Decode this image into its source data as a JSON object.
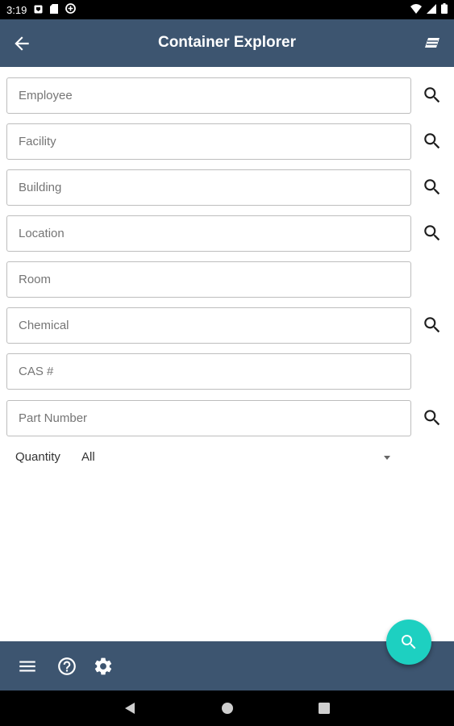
{
  "status_bar": {
    "time": "3:19",
    "left_icons": [
      "notification-icon",
      "sd-card-icon",
      "sync-icon"
    ],
    "right_icons": [
      "wifi-icon",
      "signal-icon",
      "battery-icon"
    ]
  },
  "app_bar": {
    "title": "Container Explorer",
    "back_icon": "arrow-left-icon",
    "clear_icon": "eraser-icon",
    "color": "#3d5570"
  },
  "form": {
    "fields": [
      {
        "placeholder": "Employee",
        "value": "",
        "has_search": true
      },
      {
        "placeholder": "Facility",
        "value": "",
        "has_search": true
      },
      {
        "placeholder": "Building",
        "value": "",
        "has_search": true
      },
      {
        "placeholder": "Location",
        "value": "",
        "has_search": true
      },
      {
        "placeholder": "Room",
        "value": "",
        "has_search": false
      },
      {
        "placeholder": "Chemical",
        "value": "",
        "has_search": true
      },
      {
        "placeholder": "CAS #",
        "value": "",
        "has_search": false
      },
      {
        "placeholder": "Part Number",
        "value": "",
        "has_search": true
      }
    ],
    "quantity": {
      "label": "Quantity",
      "selected": "All"
    }
  },
  "fab": {
    "icon": "search-icon",
    "color": "#1dd0c1"
  },
  "bottom_bar": {
    "icons": [
      "menu-icon",
      "help-icon",
      "settings-icon"
    ]
  },
  "nav_bar": {
    "icons": [
      "back-triangle-icon",
      "home-circle-icon",
      "recents-square-icon"
    ]
  }
}
